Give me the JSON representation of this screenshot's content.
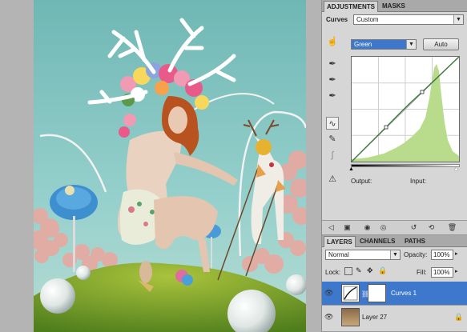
{
  "panel_tabs": {
    "adjustments": "ADJUSTMENTS",
    "masks": "MASKS"
  },
  "curves": {
    "label": "Curves",
    "preset": "Custom",
    "channel": "Green",
    "auto": "Auto",
    "output": "Output:",
    "input": "Input:"
  },
  "layers_tabs": {
    "layers": "LAYERS",
    "channels": "CHANNELS",
    "paths": "PATHS"
  },
  "layers_panel": {
    "blend_mode": "Normal",
    "opacity_label": "Opacity:",
    "opacity_value": "100%",
    "lock_label": "Lock:",
    "fill_label": "Fill:",
    "fill_value": "100%",
    "layers": [
      {
        "name": "Curves 1",
        "selected": true
      },
      {
        "name": "Layer 27",
        "selected": false
      }
    ]
  },
  "icons": [
    "hand-adjust-icon",
    "eyedropper-black-icon",
    "eyedropper-gray-icon",
    "eyedropper-white-icon",
    "curve-edit-icon",
    "pencil-icon",
    "smooth-icon",
    "clip-warning-icon",
    "back-icon",
    "view-icon",
    "visibility-icon",
    "eye-icon",
    "previous-state-icon",
    "reset-icon",
    "trash-icon",
    "lock-icon",
    "chain-icon"
  ],
  "colors": {
    "selection": "#3d78cc",
    "histogram": "#b8dc8c",
    "curve": "#3a7a3a",
    "sky": "#7fc6c4",
    "grass": "#6a9a2a"
  }
}
